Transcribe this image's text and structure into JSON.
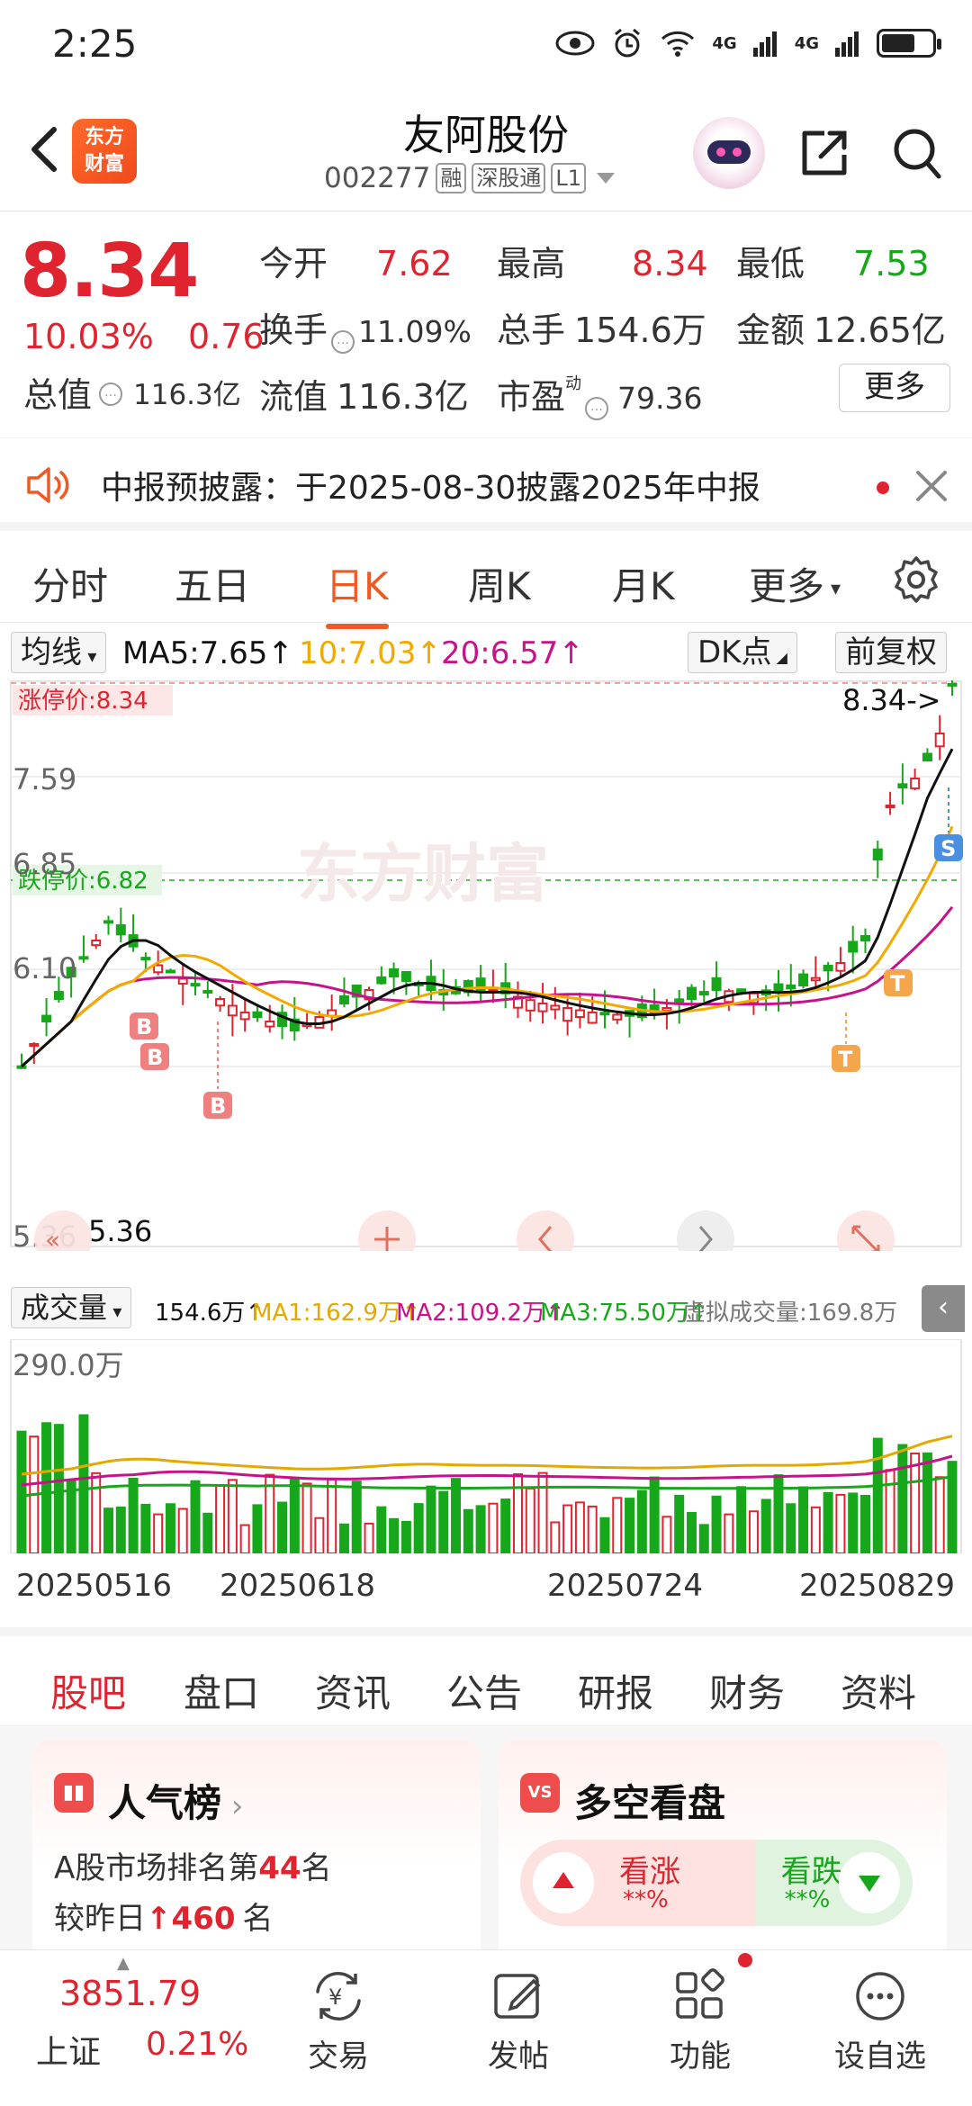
{
  "status_bar": {
    "time": "2:25",
    "net1": "4G",
    "net2": "4G"
  },
  "header": {
    "brand": "东方\n财富",
    "stock_name": "友阿股份",
    "stock_code": "002277",
    "tags": [
      "融",
      "深股通",
      "L1"
    ]
  },
  "quote": {
    "price": "8.34",
    "change_pct": "10.03%",
    "change_amt": "0.76",
    "market_value_label": "总值",
    "market_value": "116.3亿",
    "fields": [
      {
        "label": "今开",
        "value": "7.62",
        "color": "red"
      },
      {
        "label": "最高",
        "value": "8.34",
        "color": "red"
      },
      {
        "label": "最低",
        "value": "7.53",
        "color": "green"
      },
      {
        "label": "换手",
        "value": "11.09%",
        "color": "dark"
      },
      {
        "label": "总手",
        "value": "154.6万",
        "color": "dark"
      },
      {
        "label": "金额",
        "value": "12.65亿",
        "color": "dark"
      },
      {
        "label": "流值",
        "value": "116.3亿",
        "color": "dark"
      },
      {
        "label": "市盈",
        "value": "79.36",
        "color": "dark"
      }
    ],
    "pe_superscript": "动",
    "more_label": "更多"
  },
  "notice": {
    "text": "中报预披露：于2025-08-30披露2025年中报"
  },
  "period_tabs": [
    "分时",
    "五日",
    "日K",
    "周K",
    "月K",
    "更多"
  ],
  "active_period": "日K",
  "ma_row": {
    "indicator": "均线",
    "ma5": "MA5:7.65",
    "ma10": "10:7.03",
    "ma20": "20:6.57",
    "dk": "DK点",
    "adjust": "前复权"
  },
  "kline": {
    "limit_up": "涨停价:8.34",
    "limit_down": "跌停价:6.82",
    "ticks": [
      "8.34",
      "7.59",
      "6.85",
      "6.10",
      "5.36"
    ],
    "last_label": "8.34->",
    "low_label": "5.36",
    "watermark": "东方财富",
    "markers": {
      "b": "B",
      "s": "S",
      "t": "T"
    }
  },
  "volume": {
    "indicator": "成交量",
    "total": "154.6万",
    "ma1": "MA1:162.9万",
    "ma2": "MA2:109.2万",
    "ma3": "MA3:75.50万",
    "virtual": "虚拟成交量:169.8万",
    "max_tick": "290.0万"
  },
  "dates": [
    "20250516",
    "20250618",
    "20250724",
    "20250829"
  ],
  "content_tabs": [
    "股吧",
    "盘口",
    "资讯",
    "公告",
    "研报",
    "财务",
    "资料"
  ],
  "active_content_tab": "股吧",
  "popularity_card": {
    "title": "人气榜",
    "line1_prefix": "A股市场排名第",
    "rank": "44",
    "line1_suffix": "名",
    "line2_prefix": "较昨日",
    "delta": "460",
    "line2_suffix": "名"
  },
  "sentiment_card": {
    "title": "多空看盘",
    "icon": "VS",
    "bull_label": "看涨",
    "bull_value": "**%",
    "bear_label": "看跌",
    "bear_value": "**%"
  },
  "bottom_bar": {
    "index_value": "3851.79",
    "index_name": "上证",
    "index_pct": "0.21%",
    "nav": [
      "交易",
      "发帖",
      "功能",
      "设自选"
    ]
  },
  "colors": {
    "up": "#e0242f",
    "down": "#16a81a",
    "accent": "#ee5a24",
    "ma5": "#111111",
    "ma10": "#f2a900",
    "ma20": "#c8128a"
  }
}
